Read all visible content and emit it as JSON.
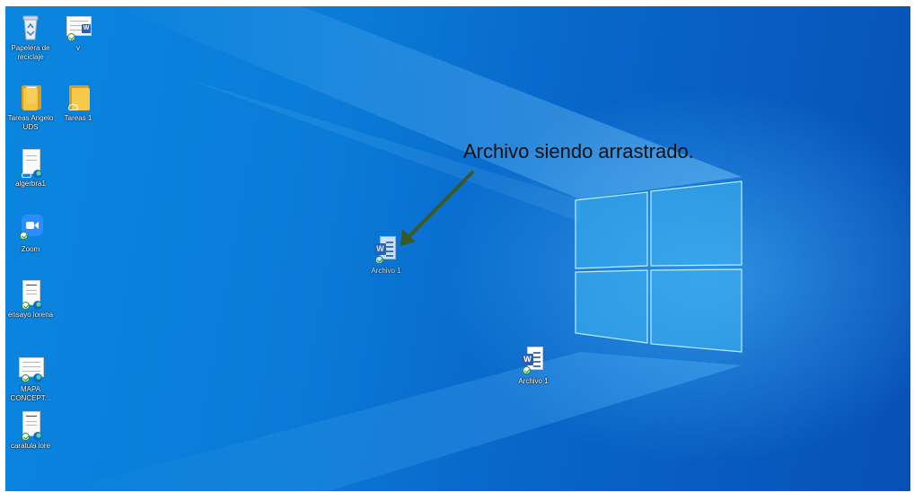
{
  "desktop": {
    "icons": [
      {
        "label": "Papelera de reciclaje",
        "icon": "recycle-bin-icon"
      },
      {
        "label": "v",
        "icon": "word-document-icon"
      },
      {
        "label": "Tareas Angelo UDS",
        "icon": "folder-icon"
      },
      {
        "label": "Tareas 1",
        "icon": "folder-icon"
      },
      {
        "label": "algerbra1",
        "icon": "pdf-document-icon"
      },
      {
        "label": "Zoom",
        "icon": "zoom-icon"
      },
      {
        "label": "ensayo lorena",
        "icon": "pdf-document-icon"
      },
      {
        "label": "MAPA CONCEPT...",
        "icon": "pdf-document-icon"
      },
      {
        "label": "caratula lore",
        "icon": "pdf-document-icon"
      },
      {
        "label": "Archivo 1",
        "icon": "word-document-icon",
        "state": "being-dragged"
      },
      {
        "label": "Archivo 1",
        "icon": "word-document-icon"
      }
    ]
  },
  "annotation": {
    "text": "Archivo siendo arrastrado.",
    "arrow_color": "#3b5a23"
  },
  "colors": {
    "wallpaper": "#0a7bd8",
    "logo_glow": "#8fe3ff",
    "word_blue": "#2b5eb6",
    "folder_yellow": "#f7c948"
  }
}
